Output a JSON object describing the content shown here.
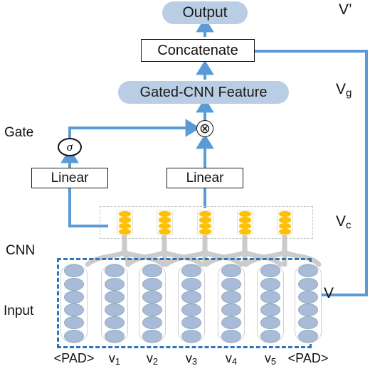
{
  "diagram": {
    "title": "Gated CNN architecture",
    "colors": {
      "pill_fill": "#b9cde4",
      "arrow_blue": "#5b9bd5",
      "dashed_blue": "#2e75b6",
      "feature_orange": "#ffc000",
      "input_blue": "#a8bcd8",
      "conv_gray": "#c9c9c9",
      "box_border": "#1a1a1a"
    },
    "nodes": {
      "output": "Output",
      "concatenate": "Concatenate",
      "gated_cnn_feature": "Gated-CNN Feature",
      "linear_gate": "Linear",
      "linear_feature": "Linear",
      "sigma": "σ",
      "multiply": "⊗"
    },
    "side_labels": [
      {
        "name": "v-prime",
        "text": "V",
        "sub": "",
        "prime": "’"
      },
      {
        "name": "v-g",
        "text": "V",
        "sub": "g",
        "prime": ""
      },
      {
        "name": "v-c",
        "text": "V",
        "sub": "c",
        "prime": ""
      },
      {
        "name": "v",
        "text": "V",
        "sub": "",
        "prime": ""
      }
    ],
    "left_labels": [
      {
        "name": "gate",
        "text": "Gate"
      },
      {
        "name": "cnn",
        "text": "CNN"
      },
      {
        "name": "input",
        "text": "Input"
      }
    ],
    "token_labels": [
      {
        "text": "<PAD>",
        "sub": ""
      },
      {
        "text": "v",
        "sub": "1"
      },
      {
        "text": "v",
        "sub": "2"
      },
      {
        "text": "v",
        "sub": "3"
      },
      {
        "text": "v",
        "sub": "4"
      },
      {
        "text": "v",
        "sub": "5"
      },
      {
        "text": "<PAD>",
        "sub": ""
      }
    ],
    "feature_columns": 5,
    "feature_units_per_column": 4,
    "input_columns": 7,
    "input_units_per_column": 6
  }
}
